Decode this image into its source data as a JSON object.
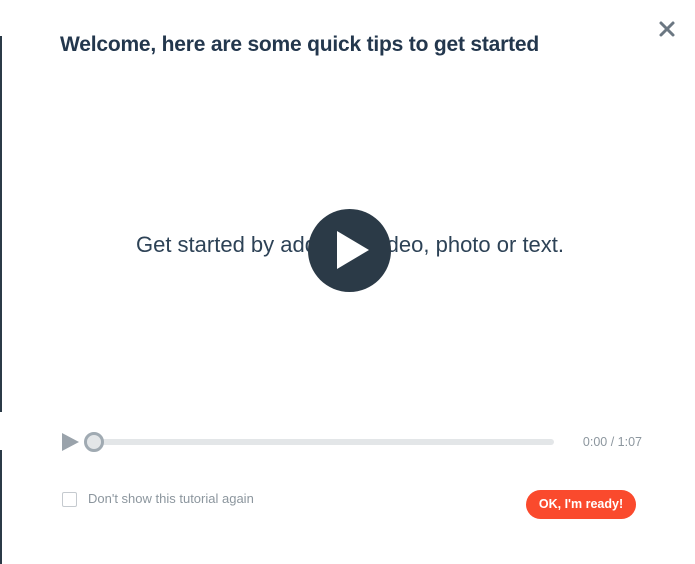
{
  "dialog": {
    "title": "Welcome, here are some quick tips to get started",
    "close_icon": "close-icon"
  },
  "video": {
    "slide_text": "Get started by adding a video, photo or text.",
    "big_play_icon": "play-icon",
    "progress_fraction": 0,
    "time_display": "0:00 / 1:07"
  },
  "footer": {
    "dont_show_label": "Don't show this tutorial again",
    "dont_show_checked": false,
    "ready_button_label": "OK, I'm ready!"
  },
  "colors": {
    "title": "#23374d",
    "accent_button": "#fa4a2d",
    "play_button": "#2b3a47",
    "muted_text": "#8c969e",
    "track": "#e3e6e8"
  }
}
